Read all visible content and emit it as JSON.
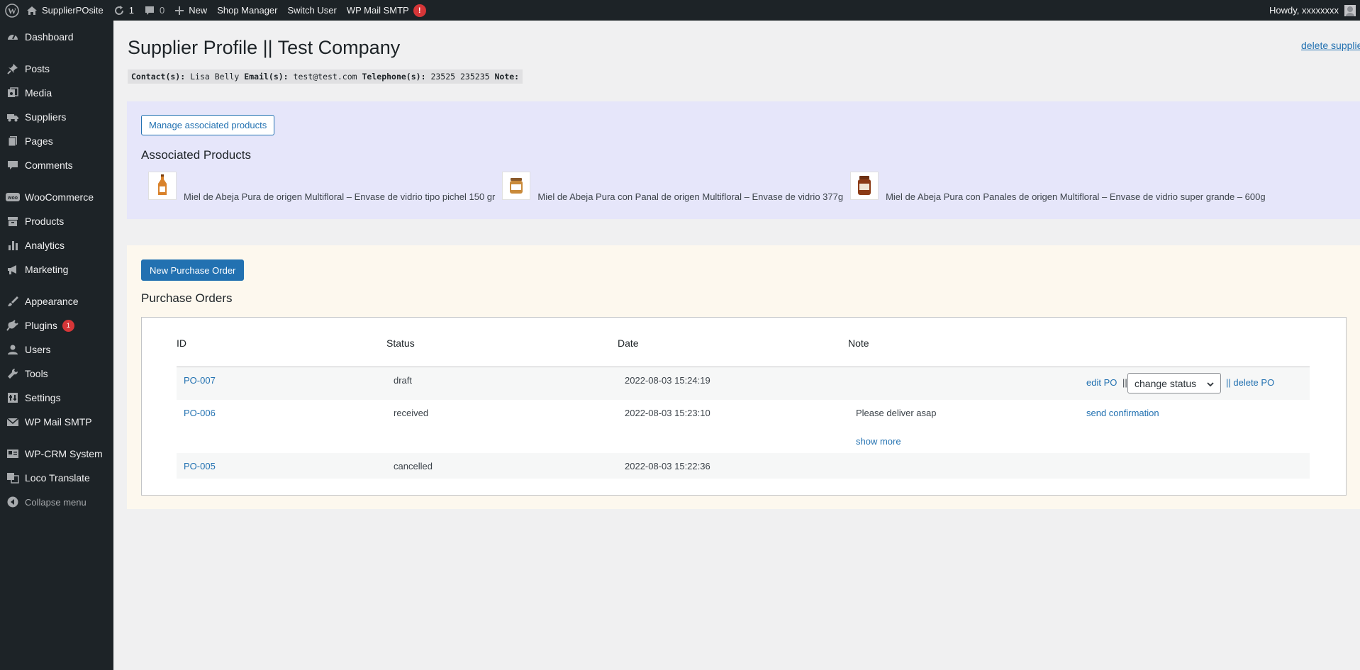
{
  "adminbar": {
    "site_name": "SupplierPOsite",
    "updates_count": "1",
    "comments_count": "0",
    "new_label": "New",
    "shop_manager": "Shop Manager",
    "switch_user": "Switch User",
    "wp_mail_smtp": "WP Mail SMTP",
    "smtp_alert": "!",
    "howdy": "Howdy, xxxxxxxx"
  },
  "sidebar": {
    "items": [
      {
        "label": "Dashboard",
        "icon": "dashboard-icon"
      },
      {
        "label": "Posts",
        "icon": "pin-icon"
      },
      {
        "label": "Media",
        "icon": "media-icon"
      },
      {
        "label": "Suppliers",
        "icon": "truck-icon"
      },
      {
        "label": "Pages",
        "icon": "pages-icon"
      },
      {
        "label": "Comments",
        "icon": "comment-icon"
      },
      {
        "label": "WooCommerce",
        "icon": "woo-icon"
      },
      {
        "label": "Products",
        "icon": "archive-icon"
      },
      {
        "label": "Analytics",
        "icon": "bar-chart-icon"
      },
      {
        "label": "Marketing",
        "icon": "megaphone-icon"
      },
      {
        "label": "Appearance",
        "icon": "brush-icon"
      },
      {
        "label": "Plugins",
        "icon": "plug-icon",
        "badge": "1"
      },
      {
        "label": "Users",
        "icon": "user-icon"
      },
      {
        "label": "Tools",
        "icon": "wrench-icon"
      },
      {
        "label": "Settings",
        "icon": "settings-icon"
      },
      {
        "label": "WP Mail SMTP",
        "icon": "mail-icon"
      },
      {
        "label": "WP-CRM System",
        "icon": "crm-icon"
      },
      {
        "label": "Loco Translate",
        "icon": "translate-icon"
      },
      {
        "label": "Collapse menu",
        "icon": "collapse-icon"
      }
    ]
  },
  "main": {
    "title": "Supplier Profile || Test Company",
    "delete_supplier": "delete supplier",
    "contact": {
      "contacts_label": "Contact(s):",
      "contacts_value": "Lisa Belly",
      "emails_label": "Email(s):",
      "emails_value": "test@test.com",
      "telephone_label": "Telephone(s):",
      "telephone_value": "23525 235235",
      "note_label": "Note:"
    },
    "associated": {
      "manage_button": "Manage associated products",
      "heading": "Associated Products",
      "products": [
        {
          "name": "Miel de Abeja Pura de origen Multifloral – Envase de vidrio tipo pichel 150 gr"
        },
        {
          "name": "Miel de Abeja Pura con Panal de origen Multifloral – Envase de vidrio 377g"
        },
        {
          "name": "Miel de Abeja Pura con Panales de origen Multifloral – Envase de vidrio super grande – 600g"
        }
      ]
    },
    "purchase_orders": {
      "new_button": "New Purchase Order",
      "heading": "Purchase Orders",
      "columns": [
        "ID",
        "Status",
        "Date",
        "Note"
      ],
      "rows": [
        {
          "id": "PO-007",
          "status": "draft",
          "date": "2022-08-03 15:24:19",
          "note": "",
          "edit": "edit PO",
          "sep1": "||",
          "select": "change status",
          "sep_delete": "|| delete PO"
        },
        {
          "id": "PO-006",
          "status": "received",
          "date": "2022-08-03 15:23:10",
          "note": "Please deliver asap",
          "show_more": "show more",
          "action": "send confirmation"
        },
        {
          "id": "PO-005",
          "status": "cancelled",
          "date": "2022-08-03 15:22:36",
          "note": ""
        }
      ]
    }
  },
  "colors": {
    "admin_dark": "#1d2327",
    "link": "#2271b1",
    "assoc_bg": "#e6e6fa",
    "po_bg": "#fdf8ee",
    "alert": "#d63638"
  }
}
